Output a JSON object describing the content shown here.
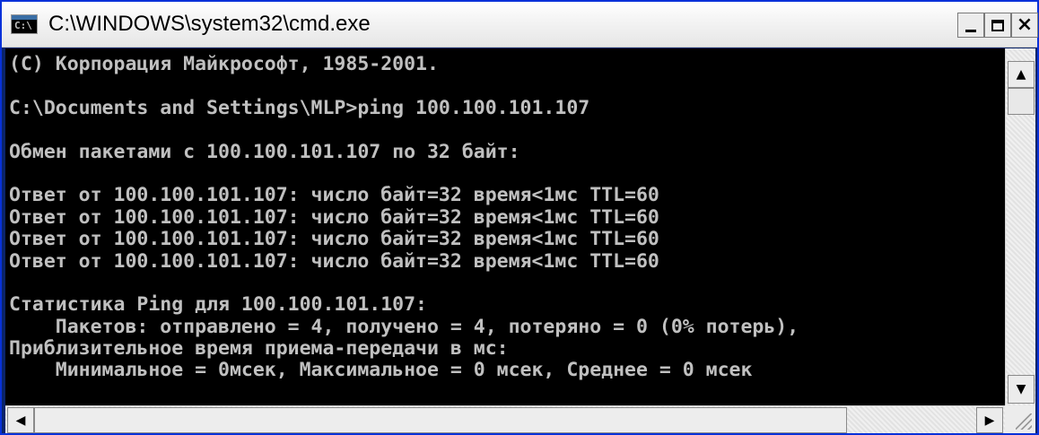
{
  "window": {
    "title": "C:\\WINDOWS\\system32\\cmd.exe",
    "icon": "console-icon",
    "icon_glyph": "C:\\",
    "buttons": {
      "minimize": "minimize-icon",
      "maximize": "maximize-icon",
      "close_glyph": "×"
    }
  },
  "console": {
    "lines": [
      "(C) Корпорация Майкрософт, 1985-2001.",
      "",
      "C:\\Documents and Settings\\MLP>ping 100.100.101.107",
      "",
      "Обмен пакетами с 100.100.101.107 по 32 байт:",
      "",
      "Ответ от 100.100.101.107: число байт=32 время<1мс TTL=60",
      "Ответ от 100.100.101.107: число байт=32 время<1мс TTL=60",
      "Ответ от 100.100.101.107: число байт=32 время<1мс TTL=60",
      "Ответ от 100.100.101.107: число байт=32 время<1мс TTL=60",
      "",
      "Статистика Ping для 100.100.101.107:",
      "    Пакетов: отправлено = 4, получено = 4, потеряно = 0 (0% потерь),",
      "Приблизительное время приема-передачи в мс:",
      "    Минимальное = 0мсек, Максимальное = 0 мсек, Среднее = 0 мсек"
    ]
  },
  "scrollbars": {
    "up_arrow": "▲",
    "down_arrow": "▼",
    "left_arrow": "◀",
    "right_arrow": "▶"
  },
  "colors": {
    "console_bg": "#000000",
    "console_fg": "#c0c0c0"
  }
}
